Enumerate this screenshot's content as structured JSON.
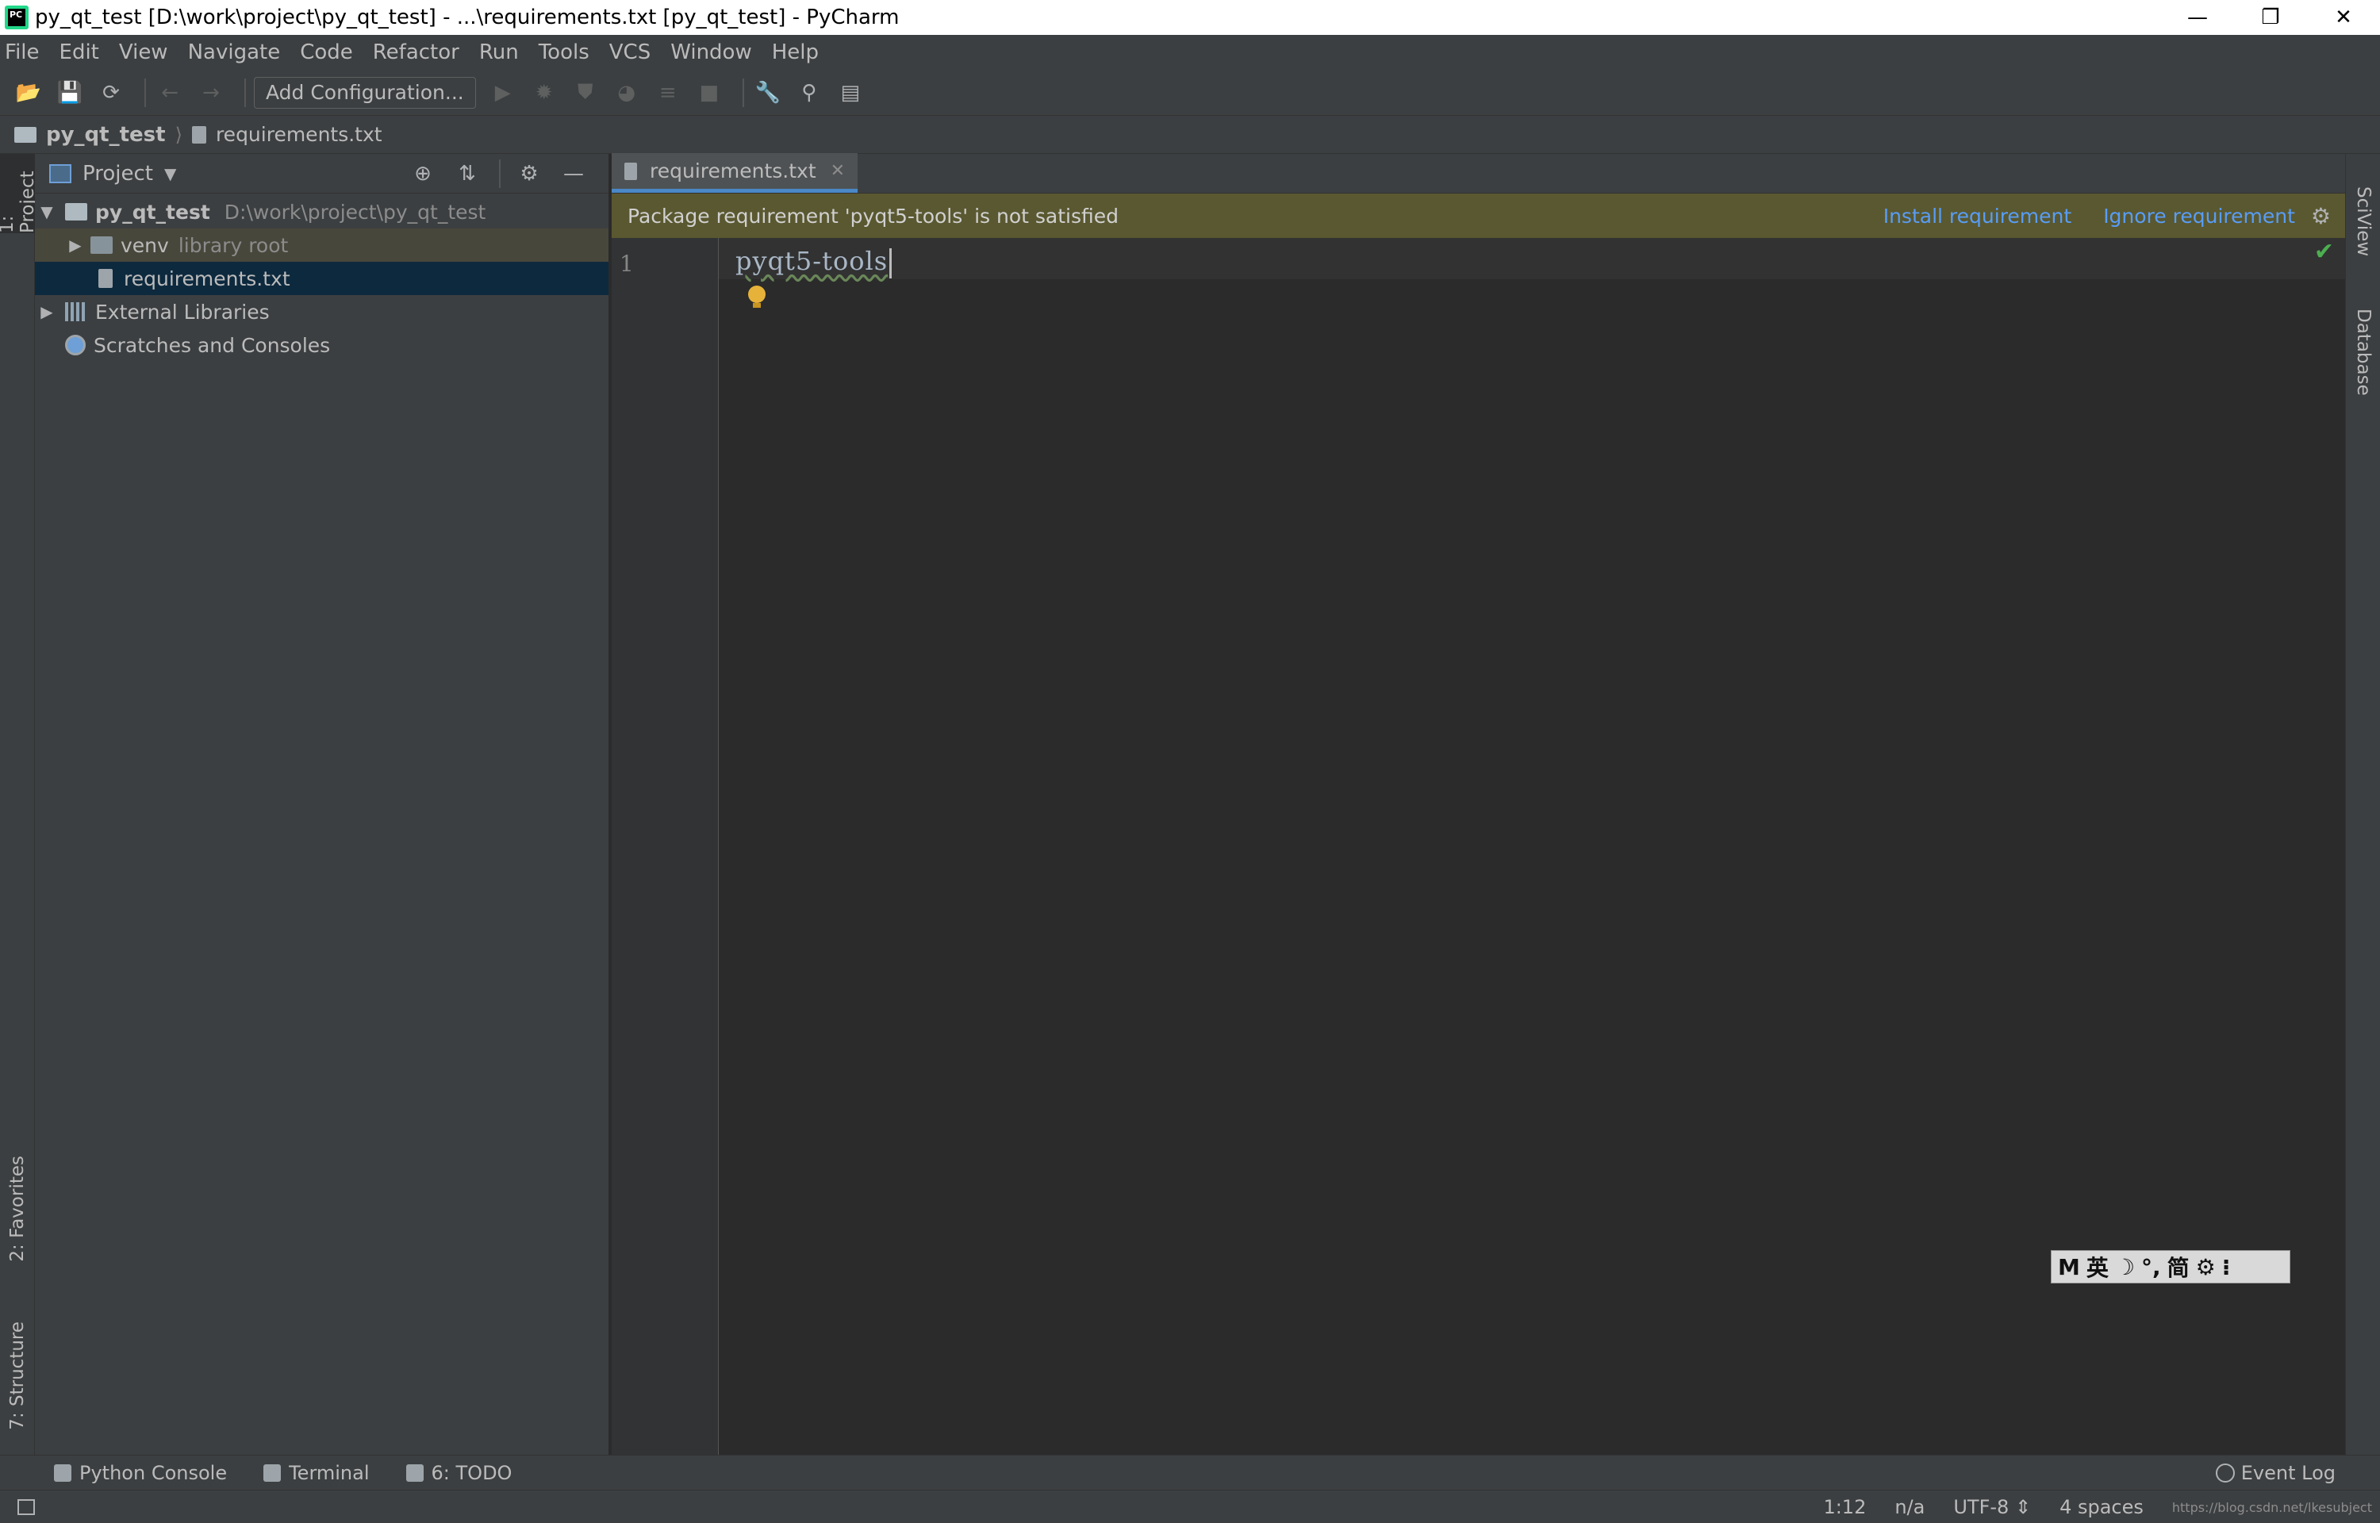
{
  "window": {
    "title": "py_qt_test [D:\\work\\project\\py_qt_test] - ...\\requirements.txt [py_qt_test] - PyCharm",
    "app_icon_text": "PC",
    "minimize": "—",
    "restore": "❐",
    "close": "✕"
  },
  "menu": [
    "File",
    "Edit",
    "View",
    "Navigate",
    "Code",
    "Refactor",
    "Run",
    "Tools",
    "VCS",
    "Window",
    "Help"
  ],
  "toolbar": {
    "add_configuration": "Add Configuration...",
    "icons": [
      "open-folder-icon",
      "save-icon",
      "sync-icon",
      "back-icon",
      "forward-icon",
      "run-icon",
      "debug-icon",
      "coverage-icon",
      "profile-icon",
      "concurrency-icon",
      "stop-icon",
      "wrench-icon",
      "search-icon",
      "terminal-structure-icon"
    ]
  },
  "breadcrumb": {
    "project": "py_qt_test",
    "file": "requirements.txt"
  },
  "left_strip": {
    "project": "1: Project",
    "favorites": "2: Favorites",
    "structure": "7: Structure"
  },
  "right_strip": {
    "sciview": "SciView",
    "database": "Database"
  },
  "project_panel": {
    "title": "Project",
    "tree": {
      "root_name": "py_qt_test",
      "root_path": "D:\\work\\project\\py_qt_test",
      "venv_name": "venv",
      "venv_note": "library root",
      "file": "requirements.txt",
      "external": "External Libraries",
      "scratches": "Scratches and Consoles"
    }
  },
  "editor": {
    "tab_label": "requirements.txt",
    "banner_message": "Package requirement 'pyqt5-tools' is not satisfied",
    "install_link": "Install requirement",
    "ignore_link": "Ignore requirement",
    "line_number": "1",
    "code": "pyqt5-tools"
  },
  "ime": {
    "m": "M",
    "lang": "英",
    "moon": "☽",
    "punct": "°,",
    "simplified": "简",
    "gear": "⚙",
    "more": "⁝"
  },
  "bottom_tabs": {
    "python_console": "Python Console",
    "terminal": "Terminal",
    "todo": "6: TODO",
    "event_log": "Event Log"
  },
  "status": {
    "position": "1:12",
    "na": "n/a",
    "encoding": "UTF-8 ⇕",
    "indent": "4 spaces",
    "watermark": "https://blog.csdn.net/lkesubject"
  },
  "colors": {
    "background": "#2b2b2b",
    "panel": "#3c3f41",
    "banner": "#5a5830",
    "link": "#589df6",
    "selection": "#0d293e"
  }
}
